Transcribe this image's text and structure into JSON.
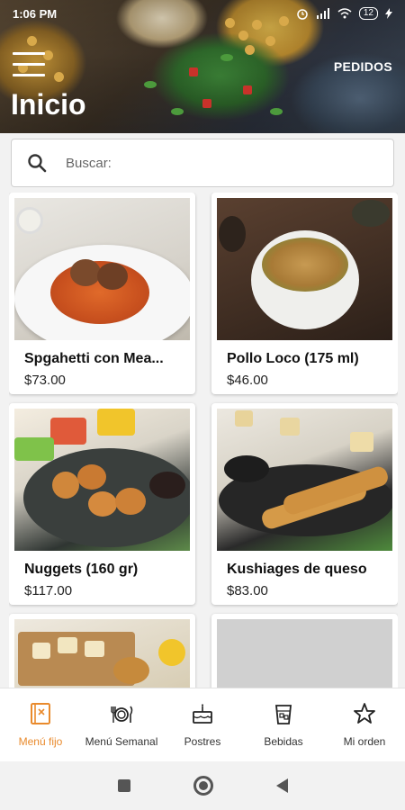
{
  "status_bar": {
    "time": "1:06 PM",
    "battery": "12"
  },
  "header": {
    "title": "Inicio",
    "orders_label": "PEDIDOS"
  },
  "search": {
    "placeholder": "Buscar:"
  },
  "products": [
    {
      "name": "Spgahetti con Mea...",
      "price": "$73.00"
    },
    {
      "name": "Pollo Loco (175 ml)",
      "price": "$46.00"
    },
    {
      "name": "Nuggets (160 gr)",
      "price": "$117.00"
    },
    {
      "name": "Kushiages de queso",
      "price": "$83.00"
    },
    {
      "name": "",
      "price": ""
    },
    {
      "name": "",
      "price": ""
    }
  ],
  "bottom_nav": [
    {
      "label": "Menú fijo",
      "icon": "menu-book-icon",
      "active": true
    },
    {
      "label": "Menú Semanal",
      "icon": "dining-icon",
      "active": false
    },
    {
      "label": "Postres",
      "icon": "cake-icon",
      "active": false
    },
    {
      "label": "Bebidas",
      "icon": "drink-icon",
      "active": false
    },
    {
      "label": "Mi orden",
      "icon": "star-icon",
      "active": false
    }
  ],
  "colors": {
    "accent": "#e98a2c",
    "text": "#111111",
    "background": "#f2f2f2"
  }
}
